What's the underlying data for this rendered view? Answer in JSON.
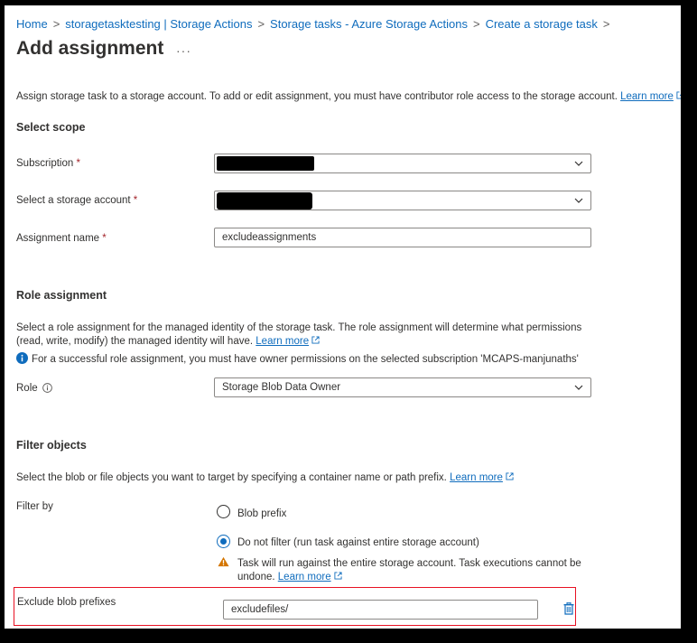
{
  "breadcrumb": [
    {
      "label": "Home"
    },
    {
      "label": "storagetasktesting | Storage Actions"
    },
    {
      "label": "Storage tasks - Azure Storage Actions"
    },
    {
      "label": "Create a storage task"
    }
  ],
  "page": {
    "title": "Add assignment",
    "more_label": "···",
    "intro": "Assign storage task to a storage account. To add or edit assignment, you must have contributor role access to the storage account.",
    "intro_link": "Learn more"
  },
  "scope": {
    "heading": "Select scope",
    "subscription_label": "Subscription",
    "storage_account_label": "Select a storage account",
    "assignment_name_label": "Assignment name",
    "assignment_name_value": "excludeassignments",
    "required_mark": "*"
  },
  "role": {
    "heading": "Role assignment",
    "desc_line1": "Select a role assignment for the managed identity of the storage task. The role assignment will determine what permissions",
    "desc_line2": "(read, write, modify) the managed identity will have.",
    "desc_link": "Learn more",
    "info_text": "For a successful role assignment, you must have owner permissions on the selected subscription 'MCAPS-manjunaths'",
    "role_label": "Role",
    "role_value": "Storage Blob Data Owner"
  },
  "filter": {
    "heading": "Filter objects",
    "desc": "Select the blob or file objects you want to target by specifying a container name or path prefix.",
    "desc_link": "Learn more",
    "filter_by_label": "Filter by",
    "options": [
      {
        "label": "Blob prefix",
        "selected": false
      },
      {
        "label": "Do not filter (run task against entire storage account)",
        "selected": true
      }
    ],
    "warning_line1": "Task will run against the entire storage account. Task executions cannot be",
    "warning_line2": "undone.",
    "warning_link": "Learn more",
    "exclude_label": "Exclude blob prefixes",
    "exclude_value": "excludefiles/"
  },
  "colors": {
    "link": "#0f6cbd",
    "info": "#0f6cbd",
    "warning": "#d47500",
    "highlight": "#e81123",
    "delete_icon": "#0f6cbd"
  },
  "icons": [
    "chevron-right-icon",
    "chevron-down-icon",
    "external-link-icon",
    "info-circle-icon",
    "info-icon",
    "warning-icon",
    "delete-icon"
  ]
}
